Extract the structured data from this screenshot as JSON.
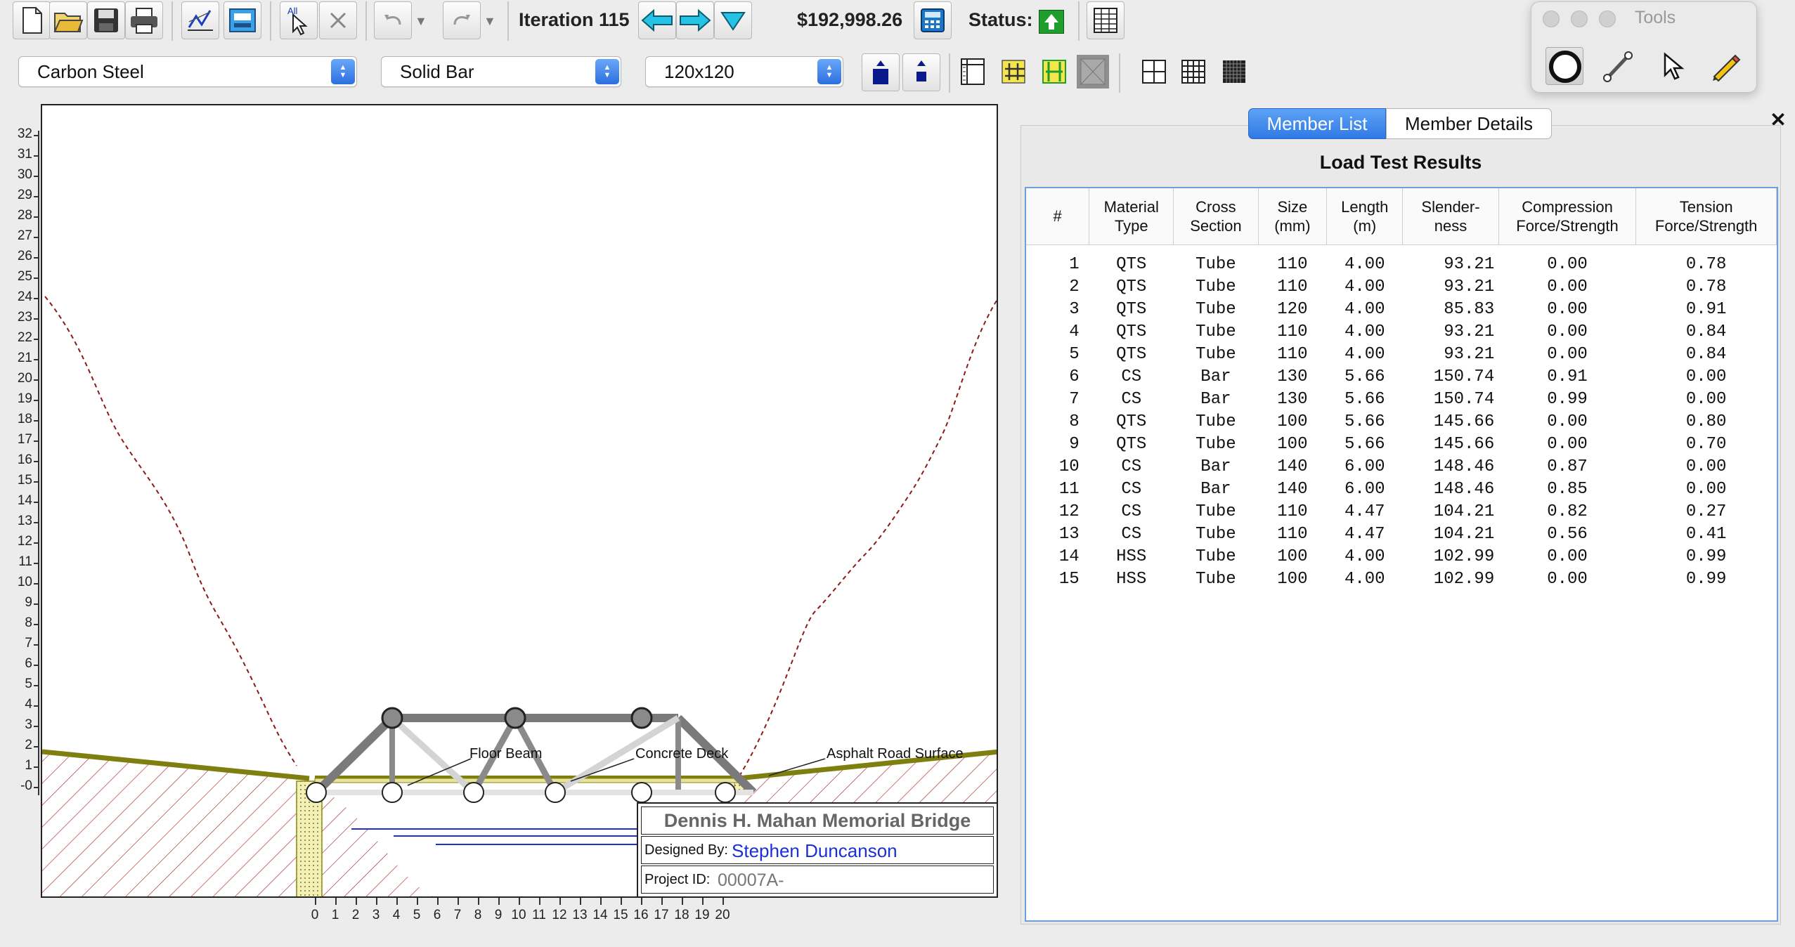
{
  "toolbar": {
    "iteration_label": "Iteration 115",
    "cost": "$192,998.26",
    "status_label": "Status:",
    "all_badge": "All",
    "icons": [
      "new-document-icon",
      "open-folder-icon",
      "save-disk-icon",
      "print-icon",
      "load-test-icon",
      "design-report-icon",
      "select-all-icon",
      "delete-icon",
      "undo-icon",
      "redo-icon",
      "back-arrow-icon",
      "forward-arrow-icon",
      "iteration-menu-icon",
      "calculator-icon",
      "status-up-icon",
      "spreadsheet-icon"
    ]
  },
  "selectors": {
    "material": "Carbon Steel",
    "section": "Solid Bar",
    "size": "120x120"
  },
  "tools_window": {
    "title": "Tools",
    "icons": [
      "circle-joint-icon",
      "member-pencil-icon",
      "pointer-icon",
      "eraser-icon"
    ]
  },
  "drawing": {
    "y_labels": [
      "32",
      "31",
      "30",
      "29",
      "28",
      "27",
      "26",
      "25",
      "24",
      "23",
      "22",
      "21",
      "20",
      "19",
      "18",
      "17",
      "16",
      "15",
      "14",
      "13",
      "12",
      "11",
      "10",
      "9",
      "8",
      "7",
      "6",
      "5",
      "4",
      "3",
      "2",
      "1",
      "-0"
    ],
    "x_labels": [
      "0",
      "1",
      "2",
      "3",
      "4",
      "5",
      "6",
      "7",
      "8",
      "9",
      "10",
      "11",
      "12",
      "13",
      "14",
      "15",
      "16",
      "17",
      "18",
      "19",
      "20"
    ],
    "annotations": {
      "floor_beam": "Floor Beam",
      "concrete_deck": "Concrete Deck",
      "asphalt": "Asphalt Road Surface"
    },
    "title_block": {
      "bridge_name": "Dennis H. Mahan Memorial Bridge",
      "designed_by_label": "Designed By:",
      "designer": "Stephen Duncanson",
      "project_id_label": "Project ID:",
      "project_id": "00007A-"
    }
  },
  "panel": {
    "tabs": [
      "Member List",
      "Member Details"
    ],
    "active_tab": "Member List",
    "title": "Load Test Results",
    "close_glyph": "✕",
    "columns": [
      "#",
      "Material\nType",
      "Cross\nSection",
      "Size\n(mm)",
      "Length\n(m)",
      "Slender-\nness",
      "Compression\nForce/Strength",
      "Tension\nForce/Strength"
    ],
    "rows": [
      [
        "1",
        "QTS",
        "Tube",
        "110",
        "4.00",
        "93.21",
        "0.00",
        "0.78"
      ],
      [
        "2",
        "QTS",
        "Tube",
        "110",
        "4.00",
        "93.21",
        "0.00",
        "0.78"
      ],
      [
        "3",
        "QTS",
        "Tube",
        "120",
        "4.00",
        "85.83",
        "0.00",
        "0.91"
      ],
      [
        "4",
        "QTS",
        "Tube",
        "110",
        "4.00",
        "93.21",
        "0.00",
        "0.84"
      ],
      [
        "5",
        "QTS",
        "Tube",
        "110",
        "4.00",
        "93.21",
        "0.00",
        "0.84"
      ],
      [
        "6",
        "CS",
        "Bar",
        "130",
        "5.66",
        "150.74",
        "0.91",
        "0.00"
      ],
      [
        "7",
        "CS",
        "Bar",
        "130",
        "5.66",
        "150.74",
        "0.99",
        "0.00"
      ],
      [
        "8",
        "QTS",
        "Tube",
        "100",
        "5.66",
        "145.66",
        "0.00",
        "0.80"
      ],
      [
        "9",
        "QTS",
        "Tube",
        "100",
        "5.66",
        "145.66",
        "0.00",
        "0.70"
      ],
      [
        "10",
        "CS",
        "Bar",
        "140",
        "6.00",
        "148.46",
        "0.87",
        "0.00"
      ],
      [
        "11",
        "CS",
        "Bar",
        "140",
        "6.00",
        "148.46",
        "0.85",
        "0.00"
      ],
      [
        "12",
        "CS",
        "Tube",
        "110",
        "4.47",
        "104.21",
        "0.82",
        "0.27"
      ],
      [
        "13",
        "CS",
        "Tube",
        "110",
        "4.47",
        "104.21",
        "0.56",
        "0.41"
      ],
      [
        "14",
        "HSS",
        "Tube",
        "100",
        "4.00",
        "102.99",
        "0.00",
        "0.99"
      ],
      [
        "15",
        "HSS",
        "Tube",
        "100",
        "4.00",
        "102.99",
        "0.00",
        "0.99"
      ]
    ]
  },
  "colors": {
    "accent": "#2f7ae5",
    "status_green": "#1f9d2d",
    "designer_blue": "#1a2fd6",
    "terrain_red": "#a52a2a",
    "deck_olive": "#8a8a10"
  }
}
